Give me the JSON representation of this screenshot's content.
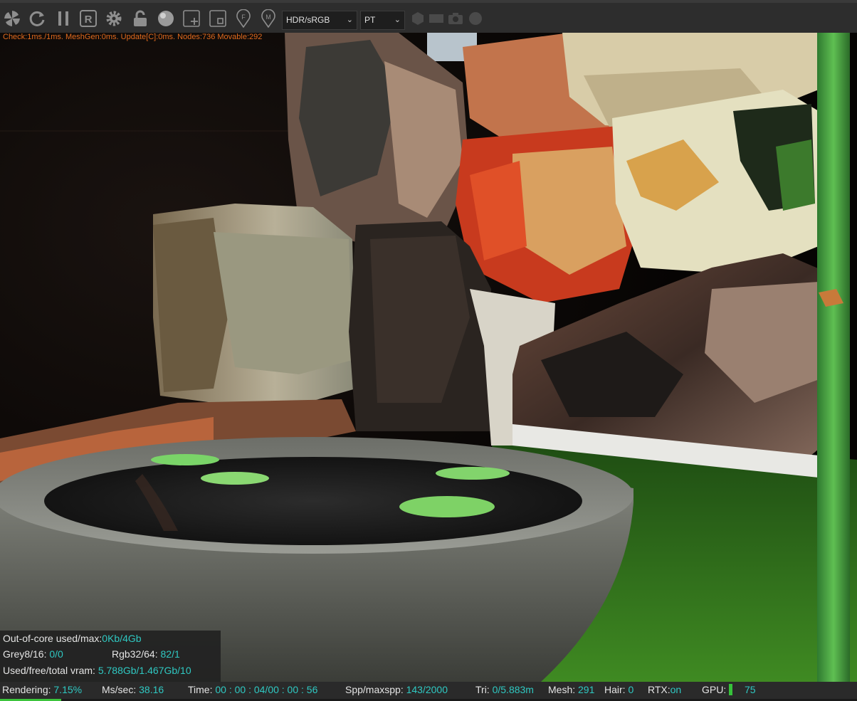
{
  "toolbar": {
    "icons": [
      "spiral-icon",
      "refresh-icon",
      "pause-icon",
      "r-icon",
      "gear-icon",
      "lock-icon",
      "sphere-icon",
      "add-region-icon",
      "region-icon",
      "f-pin-icon",
      "m-pin-icon",
      "hexagon-icon",
      "rectangle-icon",
      "camera-icon",
      "circle-icon"
    ],
    "color_mode": "HDR/sRGB",
    "kernel": "PT"
  },
  "viewport": {
    "perf_line": "Check:1ms./1ms. MeshGen:0ms. Update[C]:0ms. Nodes:736 Movable:292"
  },
  "info": {
    "ooc_label": "Out-of-core used/max:",
    "ooc_value": "0Kb/4Gb",
    "grey_label": "Grey8/16:",
    "grey_value": "0/0",
    "rgb_label": "Rgb32/64:",
    "rgb_value": "82/1",
    "vram_label": "Used/free/total vram:",
    "vram_value": "5.788Gb/1.467Gb/10"
  },
  "status": {
    "rendering_label": "Rendering:",
    "rendering_value": "7.15%",
    "ms_label": "Ms/sec:",
    "ms_value": "38.16",
    "time_label": "Time:",
    "time_value": "00 : 00 : 04/00 : 00 : 56",
    "spp_label": "Spp/maxspp:",
    "spp_value": "143/2000",
    "tri_label": "Tri:",
    "tri_value": "0/5.883m",
    "mesh_label": "Mesh:",
    "mesh_value": "291",
    "hair_label": "Hair:",
    "hair_value": "0",
    "rtx_label": "RTX:",
    "rtx_value": "on",
    "gpu_label": "GPU:",
    "gpu_value": "75",
    "progress_fraction": 0.0715
  },
  "colors": {
    "accent_value": "#2fc8c2",
    "perf_text": "#e06a1e",
    "progress": "#3cc43c"
  }
}
